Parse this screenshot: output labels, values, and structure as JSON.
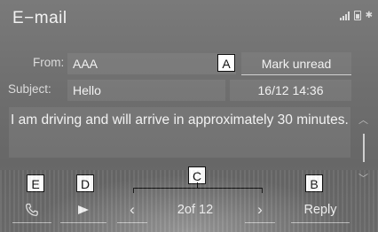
{
  "header": {
    "title": "E−mail"
  },
  "status": {
    "bluetooth_glyph": "✱"
  },
  "fields": {
    "from_label": "From:",
    "from_value": "AAA",
    "subject_label": "Subject:",
    "subject_value": "Hello",
    "datetime": "16/12 14:36"
  },
  "actions": {
    "mark_unread": "Mark unread",
    "reply": "Reply"
  },
  "message": {
    "body": "I am driving and will arrive in approximately 30 minutes."
  },
  "pager": {
    "text": "2of 12",
    "prev_glyph": "‹",
    "next_glyph": "›"
  },
  "callouts": {
    "a": "A",
    "b": "B",
    "c": "C",
    "d": "D",
    "e": "E"
  },
  "icons": {
    "phone": "phone-icon",
    "play": "play-icon",
    "signal": "signal-icon",
    "battery": "battery-icon",
    "bluetooth": "bluetooth-icon"
  },
  "colors": {
    "background": "#6e6e6e",
    "text": "#f2f2f2",
    "callout_border": "#111111"
  }
}
